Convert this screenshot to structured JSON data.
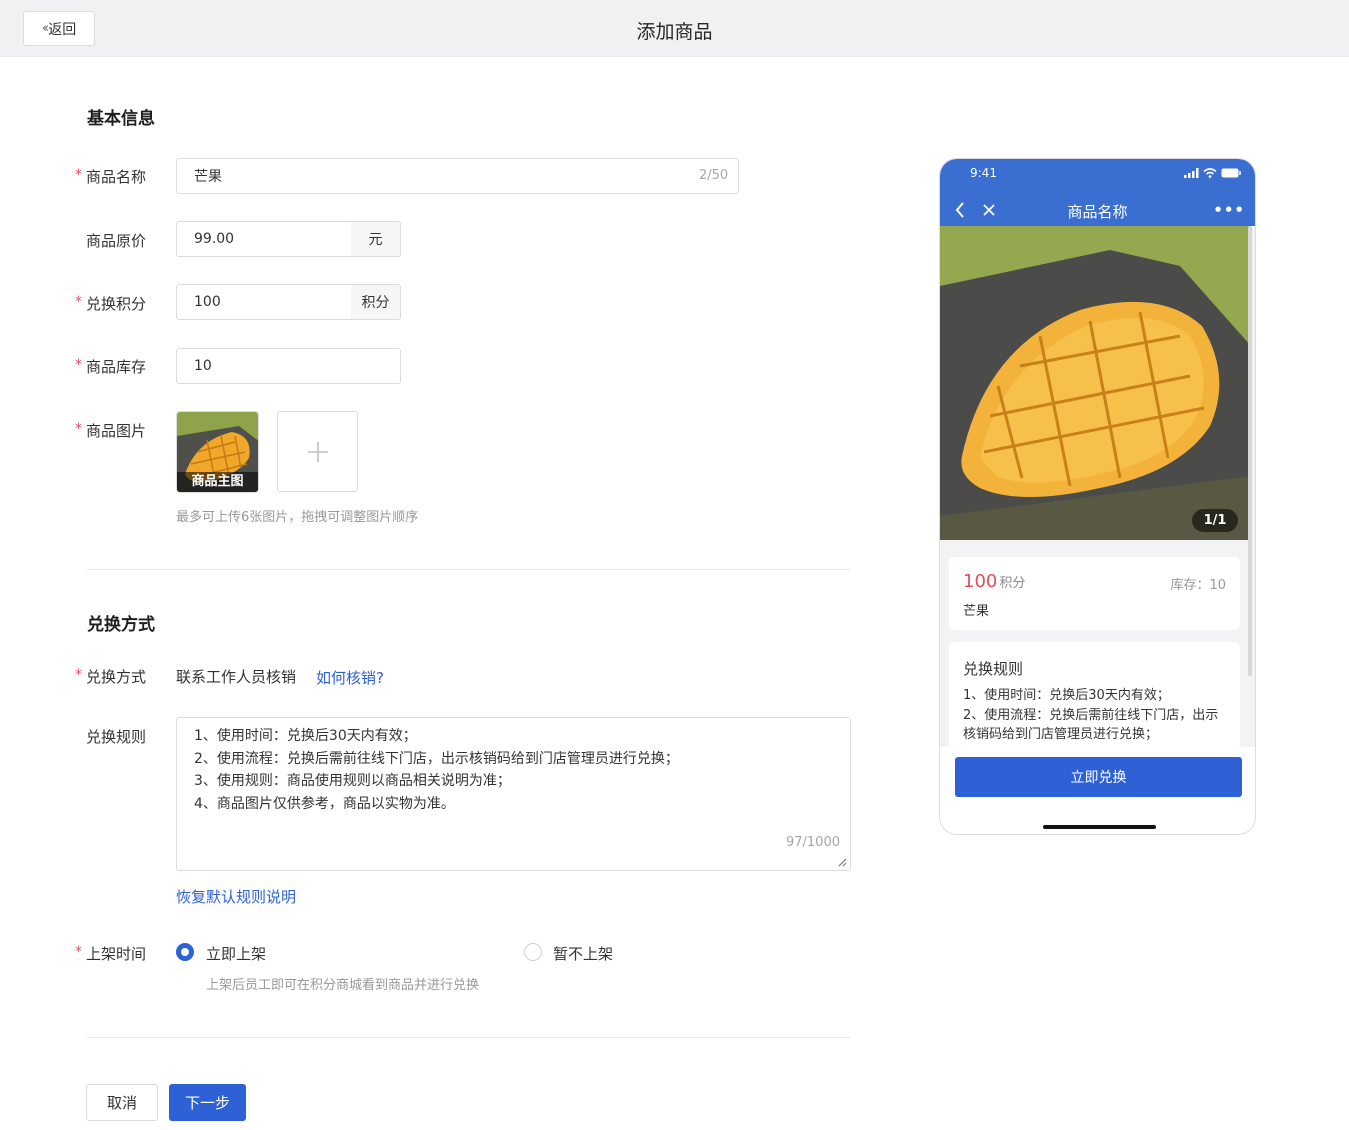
{
  "header": {
    "back_label": "返回",
    "title": "添加商品"
  },
  "basic": {
    "section_title": "基本信息",
    "name_label": "商品名称",
    "name_value": "芒果",
    "name_count": "2/50",
    "price_label": "商品原价",
    "price_value": "99.00",
    "price_unit": "元",
    "points_label": "兑换积分",
    "points_value": "100",
    "points_unit": "积分",
    "stock_label": "商品库存",
    "stock_value": "10",
    "image_label": "商品图片",
    "main_image_caption": "商品主图",
    "image_hint": "最多可上传6张图片，拖拽可调整图片顺序"
  },
  "exchange": {
    "section_title": "兑换方式",
    "method_label": "兑换方式",
    "method_value": "联系工作人员核销",
    "method_help_link": "如何核销?",
    "rules_label": "兑换规则",
    "rules_lines": [
      "1、使用时间：兑换后30天内有效；",
      "2、使用流程：兑换后需前往线下门店，出示核销码给到门店管理员进行兑换；",
      "3、使用规则：商品使用规则以商品相关说明为准；",
      "4、商品图片仅供参考，商品以实物为准。"
    ],
    "rules_count": "97/1000",
    "restore_link": "恢复默认规则说明",
    "shelf_label": "上架时间",
    "shelf_options": [
      "立即上架",
      "暂不上架"
    ],
    "shelf_selected": "立即上架",
    "shelf_hint": "上架后员工即可在积分商城看到商品并进行兑换"
  },
  "footer": {
    "cancel_label": "取消",
    "next_label": "下一步"
  },
  "preview": {
    "time": "9:41",
    "nav_title": "商品名称",
    "more": "•••",
    "pager": "1/1",
    "points": "100",
    "points_unit": "积分",
    "stock": "库存：10",
    "name": "芒果",
    "rules_title": "兑换规则",
    "rules_text": "1、使用时间：兑换后30天内有效；\n2、使用流程：兑换后需前往线下门店，出示核销码给到门店管理员进行兑换；",
    "exchange_button": "立即兑换"
  },
  "colors": {
    "primary": "#2f61d6",
    "required": "#e34d59",
    "phone_header": "#3a6fd1"
  }
}
